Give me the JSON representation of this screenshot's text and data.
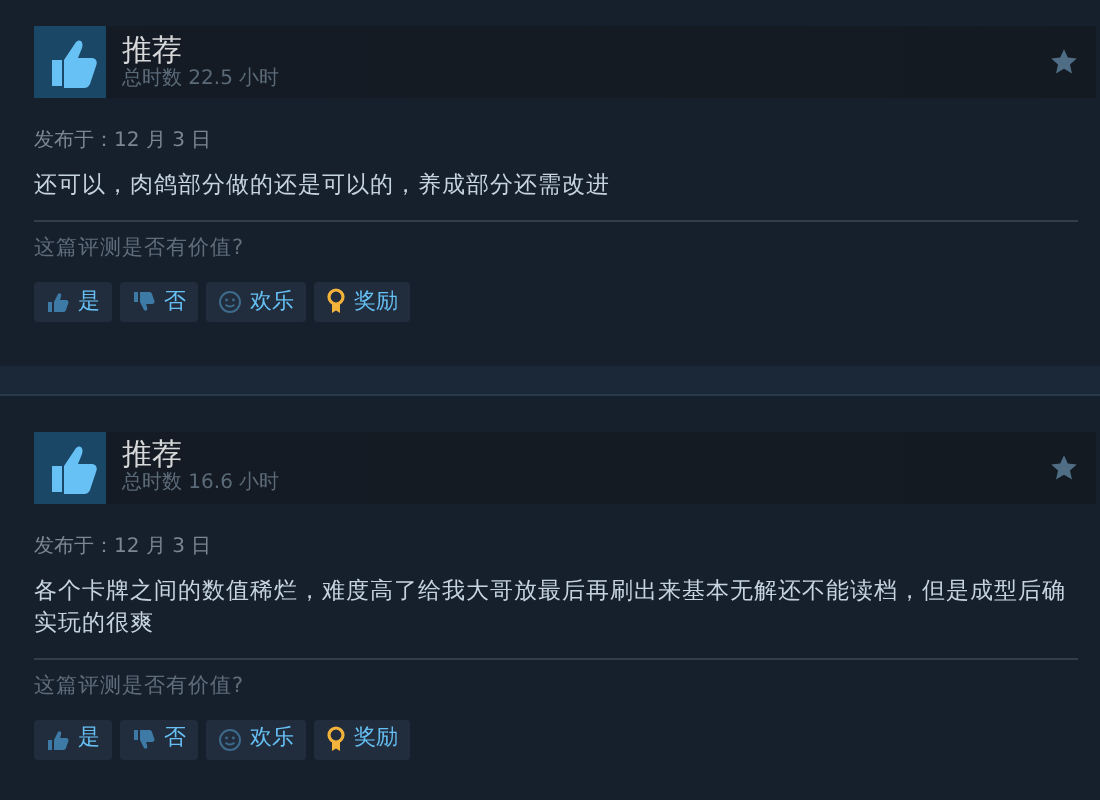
{
  "reviews": [
    {
      "recommended": true,
      "verdict": "推荐",
      "hours": "总时数 22.5 小时",
      "posted": "发布于：12 月 3 日",
      "text": "还可以，肉鸽部分做的还是可以的，养成部分还需改进",
      "helpful_prompt": "这篇评测是否有价值?",
      "buttons": [
        {
          "kind": "yes",
          "label": "是"
        },
        {
          "kind": "no",
          "label": "否"
        },
        {
          "kind": "funny",
          "label": "欢乐"
        },
        {
          "kind": "award",
          "label": "奖励"
        }
      ]
    },
    {
      "recommended": true,
      "verdict": "推荐",
      "hours": "总时数 16.6 小时",
      "posted": "发布于：12 月 3 日",
      "text": "各个卡牌之间的数值稀烂，难度高了给我大哥放最后再刷出来基本无解还不能读档，但是成型后确实玩的很爽",
      "helpful_prompt": "这篇评测是否有价值?",
      "buttons": [
        {
          "kind": "yes",
          "label": "是"
        },
        {
          "kind": "no",
          "label": "否"
        },
        {
          "kind": "funny",
          "label": "欢乐"
        },
        {
          "kind": "award",
          "label": "奖励"
        }
      ]
    }
  ]
}
